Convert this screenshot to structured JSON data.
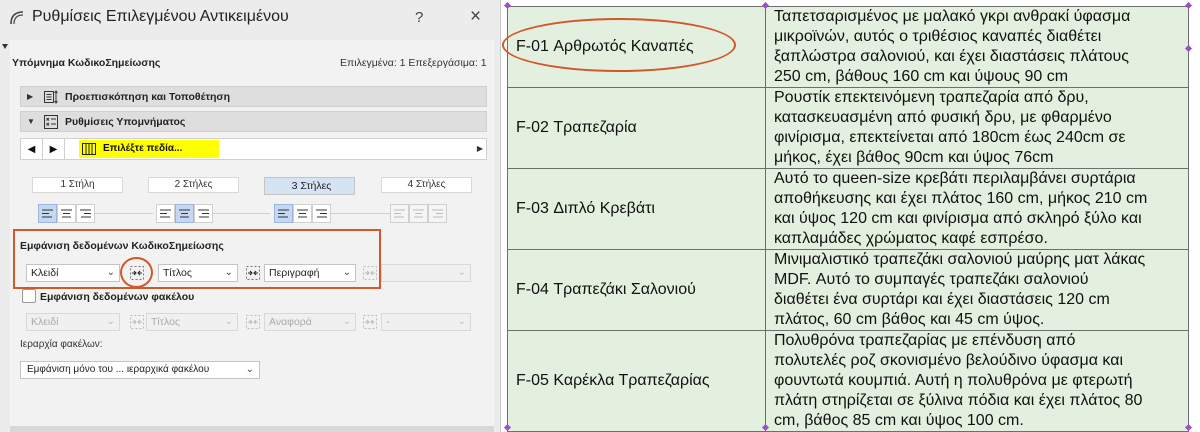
{
  "dialog": {
    "title": "Ρυθμίσεις Επιλεγμένου Αντικειμένου",
    "help_label": "?",
    "close_label": "×",
    "section_title": "Υπόμνημα ΚωδικοΣημείωσης",
    "status": "Επιλεγμένα: 1 Επεξεργάσιμα: 1",
    "accordion": [
      {
        "label": "Προεπισκόπηση και Τοποθέτηση",
        "icon": "preview-placement-icon",
        "expanded": false
      },
      {
        "label": "Ρυθμίσεις Υπομνήματος",
        "icon": "legend-settings-icon",
        "expanded": true
      }
    ],
    "field_bar": {
      "prev_label": "◀",
      "next_label": "▶",
      "field_label": "Επιλέξτε πεδία...",
      "highlight_color": "#ffff00"
    },
    "columns": [
      "1 Στήλη",
      "2 Στήλες",
      "3 Στήλες",
      "4 Στήλες"
    ],
    "selected_column": "3 Στήλες",
    "data_group": {
      "title": "Εμφάνιση δεδομένων ΚωδικοΣημείωσης",
      "fields": [
        "Κλειδί",
        "Τίτλος",
        "Περιγραφή",
        ""
      ]
    },
    "file_group": {
      "checkbox_label": "Εμφάνιση δεδομένων φακέλου",
      "checked": false,
      "fields": [
        "Κλειδί",
        "Τίτλος",
        "Αναφορά",
        "-"
      ]
    },
    "hierarchy": {
      "label": "Ιεραρχία φακέλων:",
      "value": "Εμφάνιση μόνο του ... ιεραρχικά φακέλου"
    },
    "annotation_color": "#d0582c"
  },
  "table": {
    "background": "#e4f0df",
    "rows": [
      {
        "code": "F-01 Αρθρωτός Καναπές",
        "desc": [
          "Ταπετσαρισμένος με μαλακό γκρι ανθρακί ύφασμα",
          "μικροϊνών, αυτός ο τριθέσιος καναπές διαθέτει",
          "ξαπλώστρα σαλονιού, και έχει διαστάσεις πλάτους",
          "250 cm, βάθους 160 cm και ύψους 90 cm"
        ]
      },
      {
        "code": "F-02 Τραπεζαρία",
        "desc": [
          "Ρουστίκ επεκτεινόμενη τραπεζαρία από δρυ,",
          "κατασκευασμένη από φυσική δρυ, με φθαρμένο",
          "φινίρισμα, επεκτείνεται από 180cm έως 240cm σε",
          "μήκος, έχει βάθος 90cm και ύψος 76cm"
        ]
      },
      {
        "code": "F-03 Διπλό Κρεβάτι",
        "desc": [
          "Αυτό το queen-size κρεβάτι περιλαμβάνει συρτάρια",
          "αποθήκευσης και έχει πλάτος 160 cm, μήκος 210 cm",
          "και ύψος 120 cm και φινίρισμα από σκληρό ξύλο και",
          "καπλαμάδες χρώματος καφέ εσπρέσο."
        ]
      },
      {
        "code": "F-04 Τραπεζάκι Σαλονιού",
        "desc": [
          "Μινιμαλιστικό τραπεζάκι σαλονιού μαύρης ματ λάκας",
          "MDF. Αυτό το συμπαγές τραπεζάκι σαλονιού",
          "διαθέτει ένα συρτάρι και έχει διαστάσεις 120 cm",
          "πλάτος, 60 cm βάθος και 45 cm ύψος."
        ]
      },
      {
        "code": "F-05 Καρέκλα Τραπεζαρίας",
        "desc": [
          "Πολυθρόνα τραπεζαρίας με επένδυση από",
          "πολυτελές ροζ σκονισμένο βελούδινο ύφασμα και",
          "φουντωτά κουμπιά. Αυτή η πολυθρόνα με φτερωτή",
          "πλάτη στηρίζεται σε ξύλινα πόδια και έχει πλάτος 80",
          "cm, βάθος 85 cm και ύψος 100 cm."
        ]
      }
    ]
  }
}
